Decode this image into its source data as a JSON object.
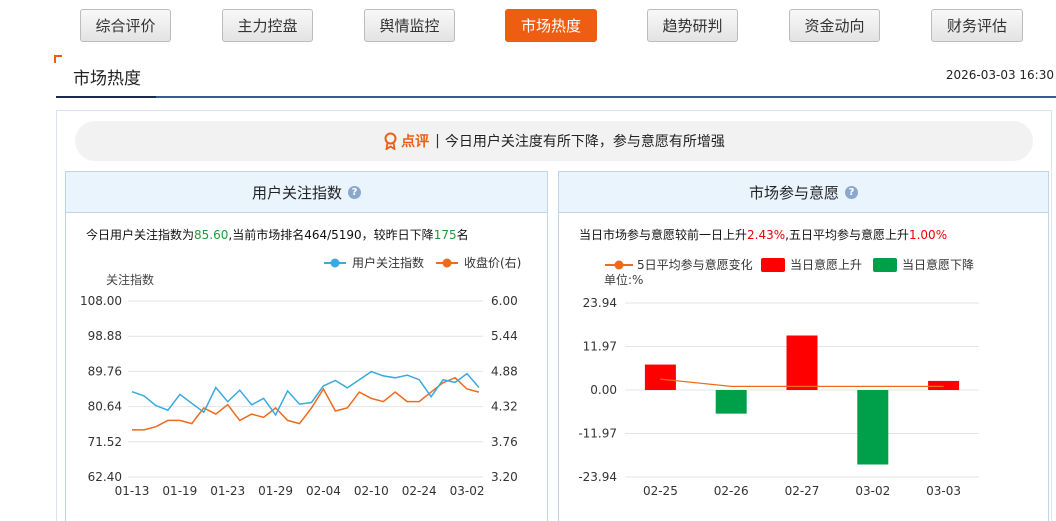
{
  "nav": {
    "tabs": [
      {
        "label": "综合评价"
      },
      {
        "label": "主力控盘"
      },
      {
        "label": "舆情监控"
      },
      {
        "label": "市场热度",
        "active": true
      },
      {
        "label": "趋势研判"
      },
      {
        "label": "资金动向"
      },
      {
        "label": "财务评估"
      }
    ]
  },
  "section": {
    "title": "市场热度",
    "timestamp": "2026-03-03 16:30"
  },
  "comment": {
    "label": "点评",
    "separator": "|",
    "text": "今日用户关注度有所下降，参与意愿有所增强"
  },
  "panel_left": {
    "title": "用户关注指数",
    "desc": {
      "p1": "今日用户关注指数为",
      "index": "85.60",
      "p2": ",当前市场排名464/5190，较昨日下降",
      "rank_change": "175",
      "p3": "名"
    }
  },
  "panel_right": {
    "title": "市场参与意愿",
    "desc": {
      "p1": "当日市场参与意愿较前一日上升",
      "day_change": "2.43%",
      "p2": ",五日平均参与意愿上升",
      "avg_change": "1.00%"
    }
  },
  "colors": {
    "accent": "#ef5d12",
    "attention_line": "#3aa9e0",
    "close_line": "#ef6a1b",
    "up_bar": "#ff0000",
    "down_bar": "#00a04a",
    "avg_line": "#ef6a1b"
  },
  "chart_data": [
    {
      "type": "line",
      "y_axis_title": "关注指数",
      "x_ticks": [
        "01-13",
        "01-19",
        "01-23",
        "01-29",
        "02-04",
        "02-10",
        "02-24",
        "03-02"
      ],
      "ylim_left": [
        62.4,
        108.0
      ],
      "yticks_left": [
        "108.00",
        "98.88",
        "89.76",
        "80.64",
        "71.52",
        "62.40"
      ],
      "ylim_right": [
        3.2,
        6.0
      ],
      "yticks_right": [
        "6.00",
        "5.44",
        "4.88",
        "4.32",
        "3.76",
        "3.20"
      ],
      "legend_position": "top-right",
      "series": [
        {
          "name": "用户关注指数",
          "axis": "left",
          "values": [
            84.5,
            83.4,
            80.9,
            79.7,
            83.8,
            81.5,
            79.2,
            85.6,
            81.9,
            84.9,
            81.1,
            82.8,
            78.5,
            84.7,
            81.3,
            81.7,
            86.0,
            87.4,
            85.5,
            87.6,
            89.7,
            88.6,
            88.1,
            88.8,
            87.6,
            83.2,
            87.6,
            86.9,
            89.2,
            85.6
          ]
        },
        {
          "name": "收盘价(右)",
          "axis": "right",
          "values": [
            3.95,
            3.95,
            4.0,
            4.1,
            4.1,
            4.05,
            4.3,
            4.2,
            4.35,
            4.1,
            4.2,
            4.15,
            4.3,
            4.1,
            4.05,
            4.3,
            4.6,
            4.25,
            4.3,
            4.55,
            4.45,
            4.4,
            4.55,
            4.4,
            4.4,
            4.55,
            4.7,
            4.78,
            4.6,
            4.55
          ]
        }
      ]
    },
    {
      "type": "bar",
      "unit_label": "单位:%",
      "categories": [
        "02-25",
        "02-26",
        "02-27",
        "03-02",
        "03-03"
      ],
      "ylim": [
        -23.94,
        23.94
      ],
      "yticks": [
        "23.94",
        "11.97",
        "0.00",
        "-11.97",
        "-23.94"
      ],
      "legend_position": "top",
      "series": [
        {
          "name": "当日意愿上升",
          "values": [
            7.0,
            null,
            15.0,
            null,
            2.5
          ]
        },
        {
          "name": "当日意愿下降",
          "values": [
            null,
            -6.5,
            null,
            -20.5,
            null
          ]
        },
        {
          "name": "5日平均参与意愿变化",
          "type": "line",
          "values": [
            3.0,
            1.0,
            1.0,
            1.0,
            1.0
          ]
        }
      ]
    }
  ]
}
